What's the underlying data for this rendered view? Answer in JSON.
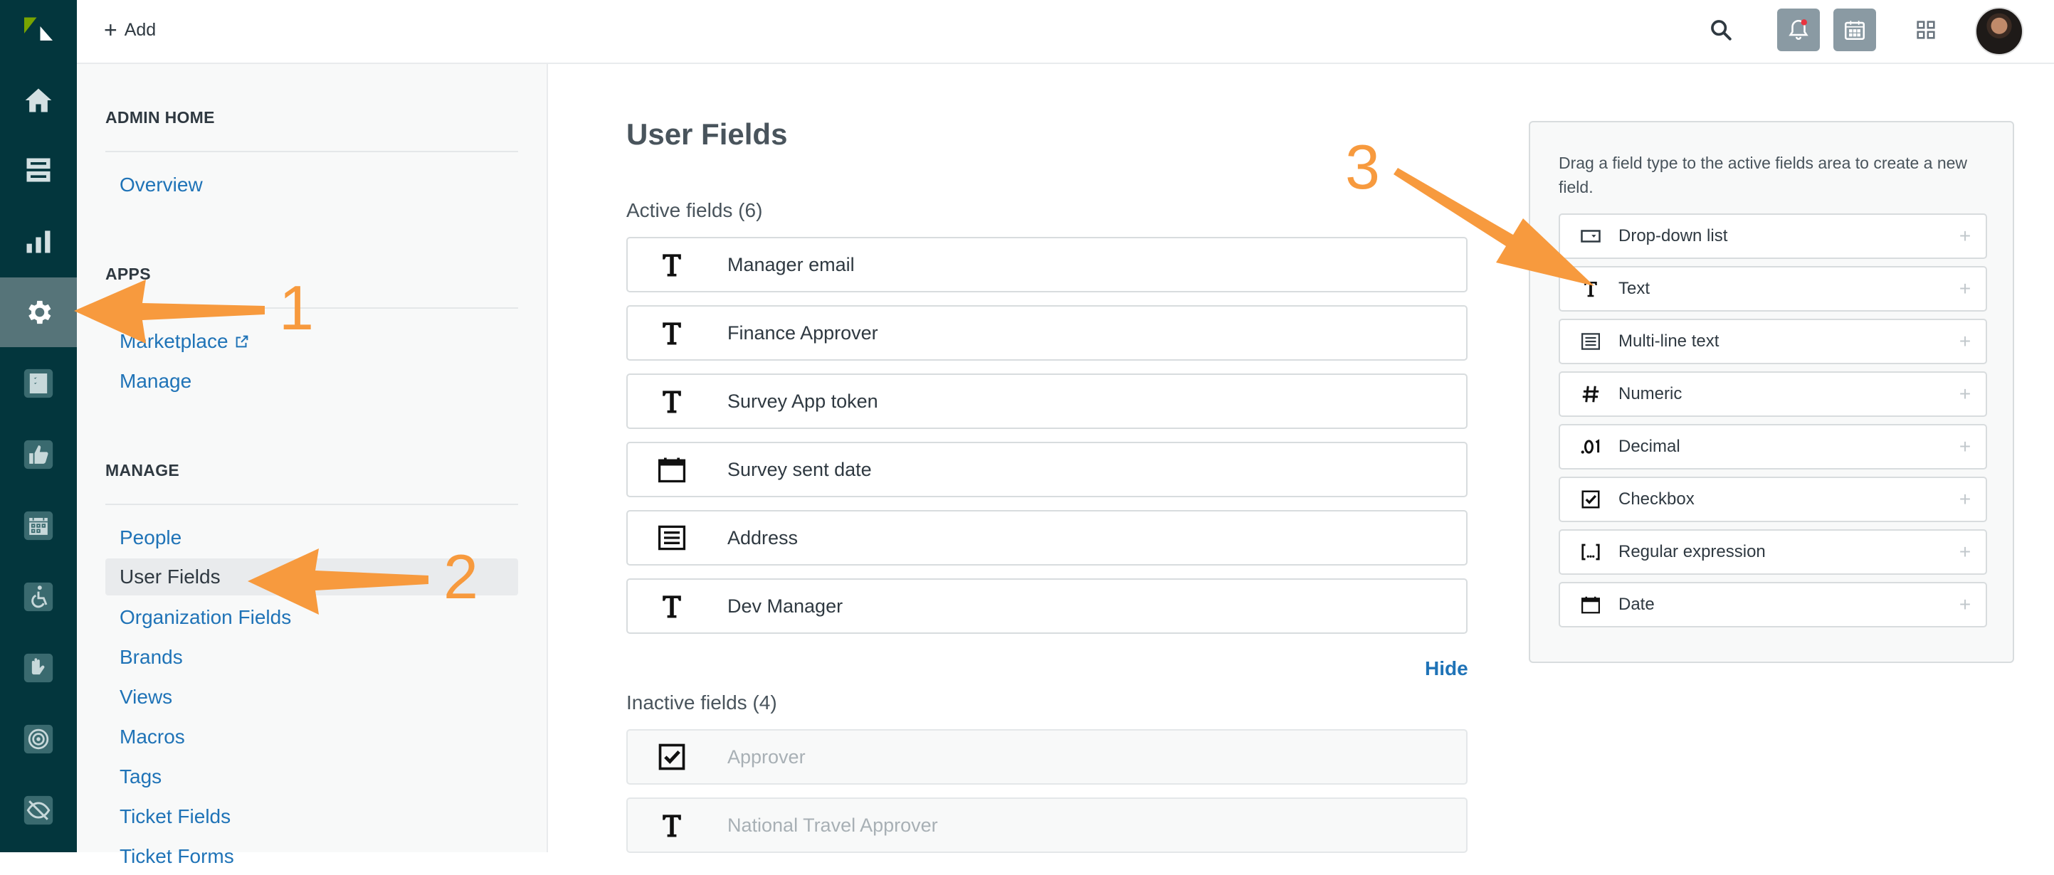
{
  "topbar": {
    "add_label": "Add",
    "icons": [
      "search-icon",
      "notification-bell-icon",
      "calendar-icon",
      "apps-grid-icon",
      "avatar"
    ]
  },
  "rail": {
    "icons": [
      "zendesk-logo",
      "home-icon",
      "views-icon",
      "reporting-icon",
      "admin-gear-icon",
      "app-checklist-icon",
      "app-thumbs-up-icon",
      "app-calendar-icon",
      "app-accessibility-icon",
      "app-hand-icon",
      "app-target-icon",
      "app-eye-off-icon"
    ]
  },
  "adminnav": {
    "home_heading": "ADMIN HOME",
    "overview": "Overview",
    "apps_heading": "APPS",
    "marketplace": "Marketplace",
    "manage_link": "Manage",
    "manage_heading": "MANAGE",
    "manage_items": [
      "People",
      "User Fields",
      "Organization Fields",
      "Brands",
      "Views",
      "Macros",
      "Tags",
      "Ticket Fields",
      "Ticket Forms"
    ]
  },
  "main": {
    "title": "User Fields",
    "active_label": "Active fields (6)",
    "active_fields": [
      {
        "label": "Manager email",
        "icon": "text"
      },
      {
        "label": "Finance Approver",
        "icon": "text"
      },
      {
        "label": "Survey App token",
        "icon": "text"
      },
      {
        "label": "Survey sent date",
        "icon": "date"
      },
      {
        "label": "Address",
        "icon": "multiline"
      },
      {
        "label": "Dev Manager",
        "icon": "text"
      }
    ],
    "hide_label": "Hide",
    "inactive_label": "Inactive fields (4)",
    "inactive_fields": [
      {
        "label": "Approver",
        "icon": "checkbox"
      },
      {
        "label": "National Travel Approver",
        "icon": "text"
      }
    ]
  },
  "palette": {
    "help": "Drag a field type to the active fields area to create a new field.",
    "types": [
      {
        "label": "Drop-down list",
        "icon": "dropdown"
      },
      {
        "label": "Text",
        "icon": "text"
      },
      {
        "label": "Multi-line text",
        "icon": "multiline"
      },
      {
        "label": "Numeric",
        "icon": "numeric"
      },
      {
        "label": "Decimal",
        "icon": "decimal"
      },
      {
        "label": "Checkbox",
        "icon": "checkbox"
      },
      {
        "label": "Regular expression",
        "icon": "regex"
      },
      {
        "label": "Date",
        "icon": "date"
      }
    ]
  },
  "annotations": {
    "step1": "1",
    "step2": "2",
    "step3": "3",
    "color": "#f79a3e"
  },
  "colors": {
    "rail_bg": "#03363d",
    "link": "#1f73b7",
    "accent_orange": "#f79a3e"
  }
}
